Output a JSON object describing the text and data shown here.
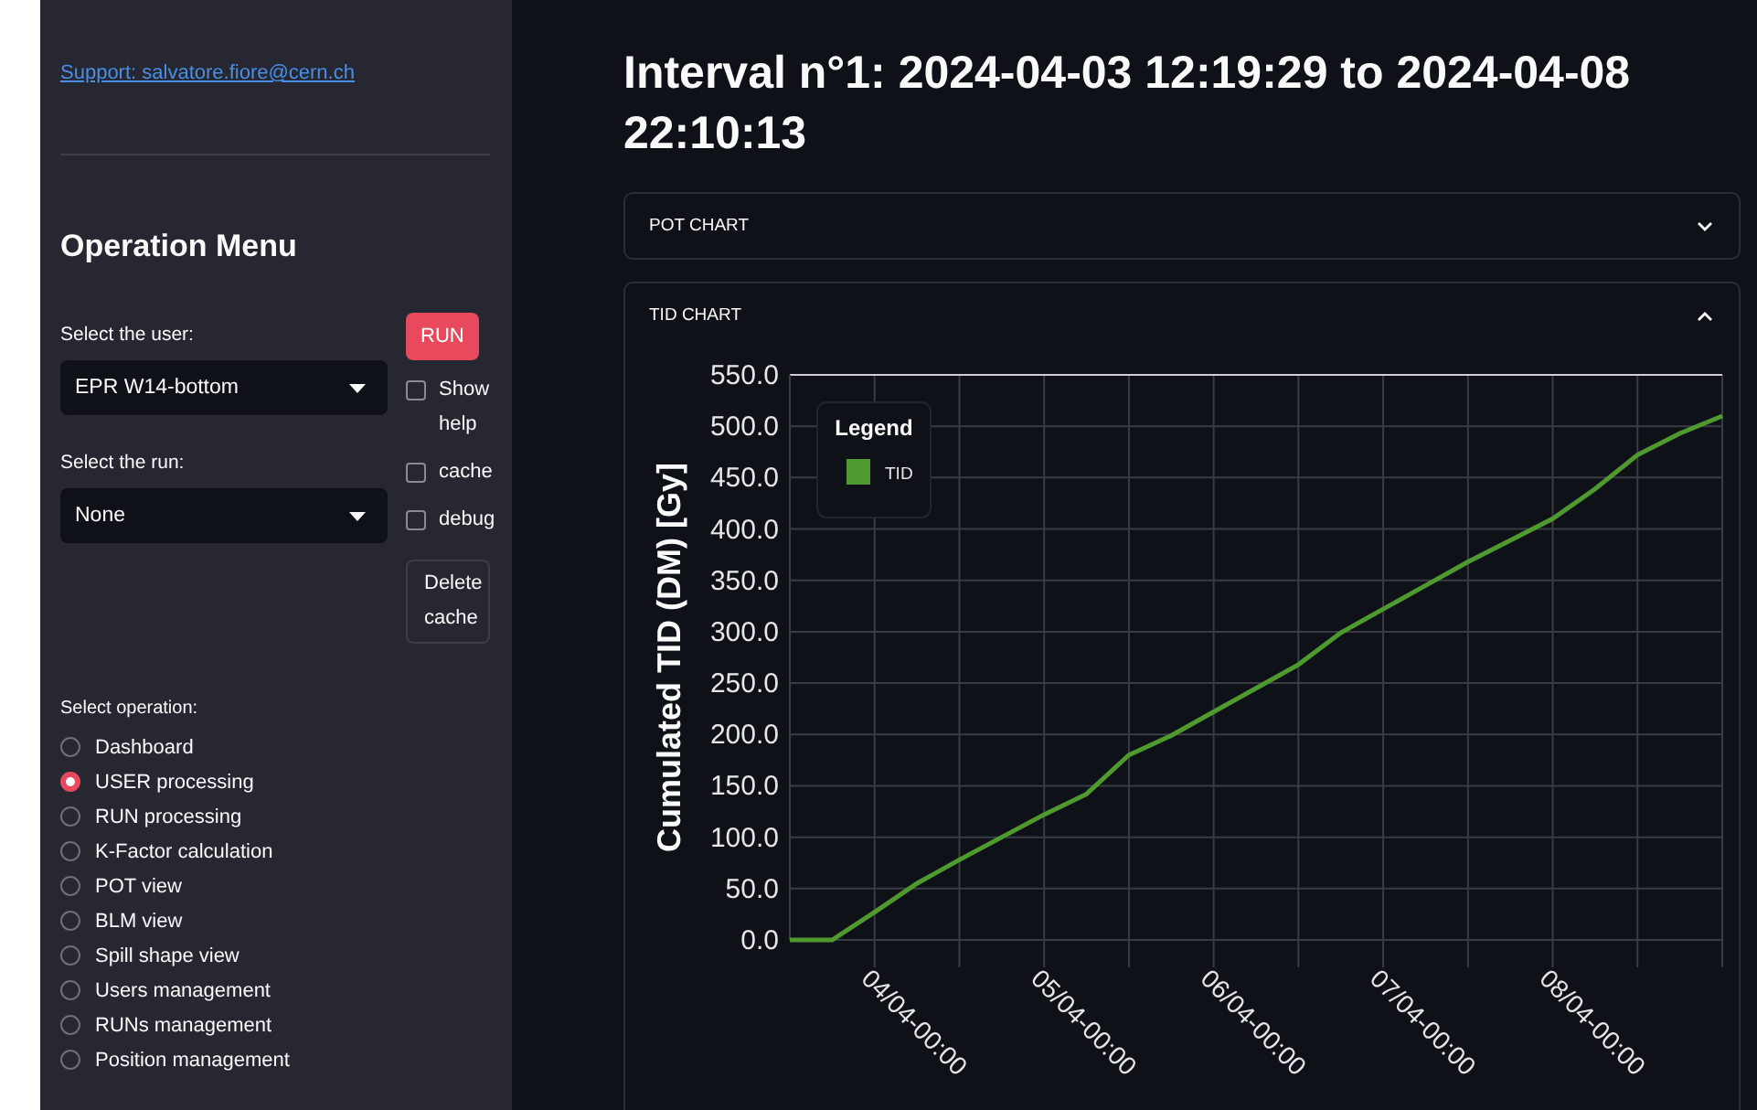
{
  "sidebar": {
    "support_link": "Support: salvatore.fiore@cern.ch",
    "heading": "Operation Menu",
    "user_select": {
      "label": "Select the user:",
      "value": "EPR W14-bottom"
    },
    "run_select": {
      "label": "Select the run:",
      "value": "None"
    },
    "run_button": "RUN",
    "checkboxes": [
      {
        "label": "Show help",
        "checked": false
      },
      {
        "label": "cache",
        "checked": false
      },
      {
        "label": "debug",
        "checked": false
      }
    ],
    "delete_button": "Delete cache",
    "operation": {
      "label": "Select operation:",
      "options": [
        {
          "label": "Dashboard",
          "selected": false
        },
        {
          "label": "USER processing",
          "selected": true
        },
        {
          "label": "RUN processing",
          "selected": false
        },
        {
          "label": "K-Factor calculation",
          "selected": false
        },
        {
          "label": "POT view",
          "selected": false
        },
        {
          "label": "BLM view",
          "selected": false
        },
        {
          "label": "Spill shape view",
          "selected": false
        },
        {
          "label": "Users management",
          "selected": false
        },
        {
          "label": "RUNs management",
          "selected": false
        },
        {
          "label": "Position management",
          "selected": false
        }
      ]
    }
  },
  "main": {
    "title": "Interval n°1: 2024-04-03 12:19:29 to 2024-04-08 22:10:13",
    "expanders": [
      {
        "label": "POT CHART",
        "expanded": false
      },
      {
        "label": "TID CHART",
        "expanded": true,
        "chart_data": {
          "type": "line",
          "ylabel": "Cumulated TID (DM) [Gy]",
          "legend_title": "Legend",
          "categories": [
            null,
            null,
            "04/04-00:00",
            null,
            null,
            null,
            "05/04-00:00",
            null,
            null,
            null,
            "06/04-00:00",
            null,
            null,
            null,
            "07/04-00:00",
            null,
            null,
            null,
            "08/04-00:00",
            null,
            null,
            null,
            null
          ],
          "series": [
            {
              "name": "TID",
              "color": "#4e9a2f",
              "values": [
                0,
                0,
                27,
                55,
                78,
                100,
                122,
                142,
                180,
                199,
                222,
                245,
                268,
                299,
                322,
                345,
                368,
                389,
                410,
                439,
                472,
                493,
                510
              ]
            }
          ],
          "ylim": [
            0,
            550
          ],
          "grid": true,
          "yticks": [
            {
              "value": 0,
              "label": "0.0"
            },
            {
              "value": 50,
              "label": "50.0"
            },
            {
              "value": 100,
              "label": "100.0"
            },
            {
              "value": 150,
              "label": "150.0"
            },
            {
              "value": 200,
              "label": "200.0"
            },
            {
              "value": 250,
              "label": "250.0"
            },
            {
              "value": 300,
              "label": "300.0"
            },
            {
              "value": 350,
              "label": "350.0"
            },
            {
              "value": 400,
              "label": "400.0"
            },
            {
              "value": 450,
              "label": "450.0"
            },
            {
              "value": 500,
              "label": "500.0"
            },
            {
              "value": 550,
              "label": "550.0"
            }
          ]
        }
      }
    ]
  }
}
